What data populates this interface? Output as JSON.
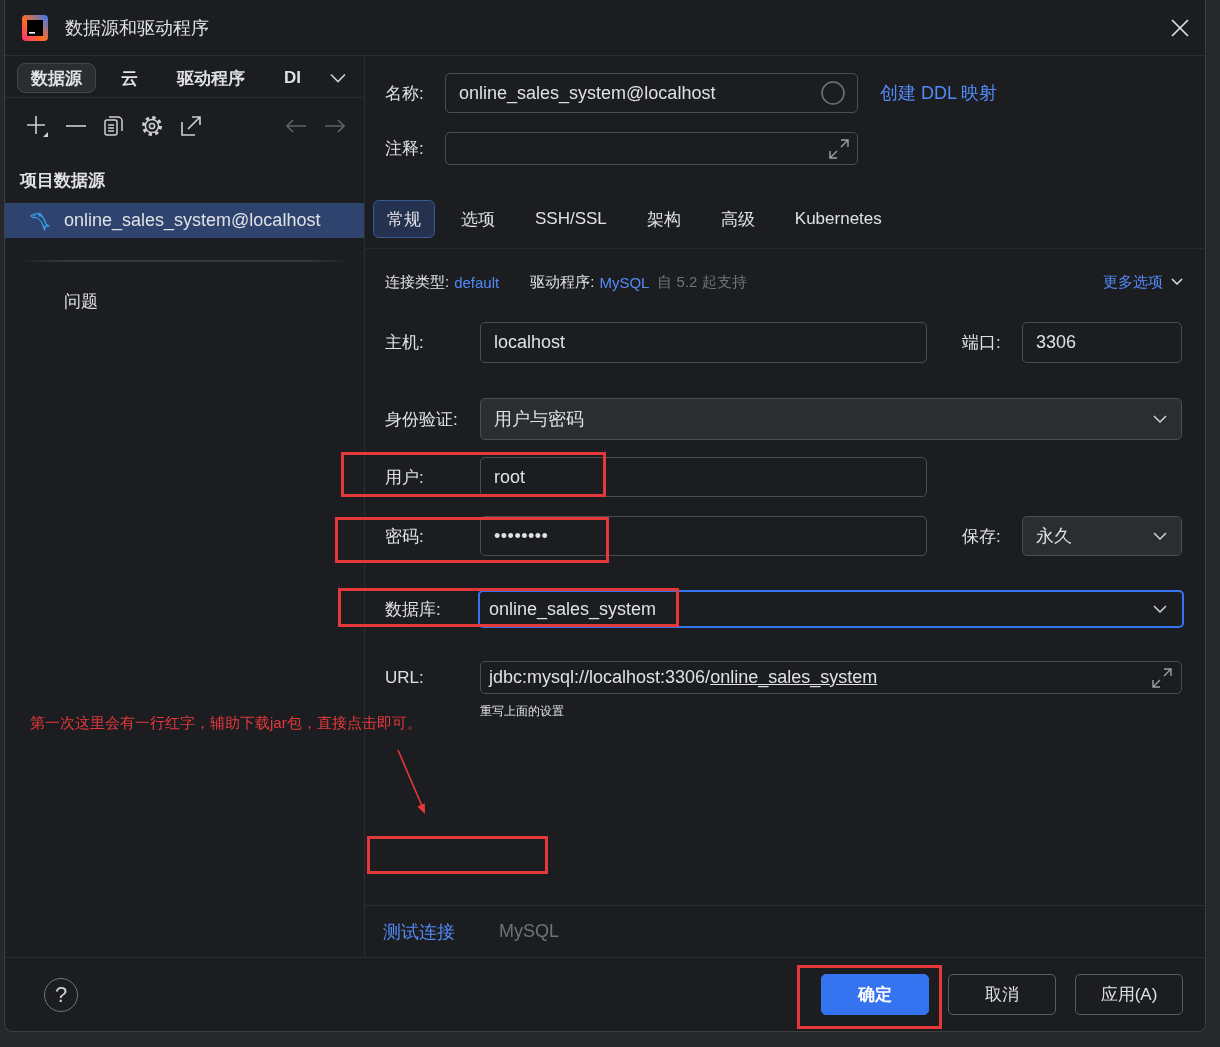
{
  "window": {
    "title": "数据源和驱动程序"
  },
  "sidebar": {
    "tabs": [
      {
        "label": "数据源",
        "selected": true
      },
      {
        "label": "云",
        "selected": false
      },
      {
        "label": "驱动程序",
        "selected": false
      },
      {
        "label": "DI",
        "selected": false
      }
    ],
    "section_title": "项目数据源",
    "items": [
      {
        "label": "online_sales_system@localhost",
        "selected": true
      }
    ],
    "problems_label": "问题"
  },
  "form": {
    "name": {
      "label": "名称:",
      "value": "online_sales_system@localhost"
    },
    "ddl_link": "创建 DDL 映射",
    "comment": {
      "label": "注释:"
    }
  },
  "tabs": [
    {
      "label": "常规",
      "selected": true
    },
    {
      "label": "选项",
      "selected": false
    },
    {
      "label": "SSH/SSL",
      "selected": false
    },
    {
      "label": "架构",
      "selected": false
    },
    {
      "label": "高级",
      "selected": false
    },
    {
      "label": "Kubernetes",
      "selected": false
    }
  ],
  "general": {
    "connection_type": {
      "label": "连接类型:",
      "value": "default"
    },
    "driver": {
      "label": "驱动程序:",
      "value": "MySQL",
      "note": "自 5.2 起支持"
    },
    "more_options": "更多选项",
    "host": {
      "label": "主机:",
      "value": "localhost"
    },
    "port": {
      "label": "端口:",
      "value": "3306"
    },
    "auth": {
      "label": "身份验证:",
      "value": "用户与密码"
    },
    "user": {
      "label": "用户:",
      "value": "root",
      "highlighted": true
    },
    "password": {
      "label": "密码:",
      "value": "••••••••",
      "highlighted": true
    },
    "save": {
      "label": "保存:",
      "value": "永久"
    },
    "database": {
      "label": "数据库:",
      "value": "online_sales_system",
      "focused": true,
      "highlighted": true
    },
    "url": {
      "label": "URL:",
      "value": "jdbc:mysql://localhost:3306/",
      "underlined": "online_sales_system",
      "hint": "重写上面的设置"
    }
  },
  "bottom_bar": {
    "test_link": "测试连接",
    "driver_name": "MySQL"
  },
  "footer": {
    "help": "?",
    "buttons": [
      {
        "label": "确定",
        "kind": "primary",
        "highlighted": true
      },
      {
        "label": "取消",
        "kind": "secondary",
        "highlighted": false
      },
      {
        "label": "应用(A)",
        "kind": "secondary",
        "highlighted": false
      }
    ]
  },
  "annotation": {
    "note": "第一次这里会有一行红字，辅助下载jar包，直接点击即可。"
  }
}
